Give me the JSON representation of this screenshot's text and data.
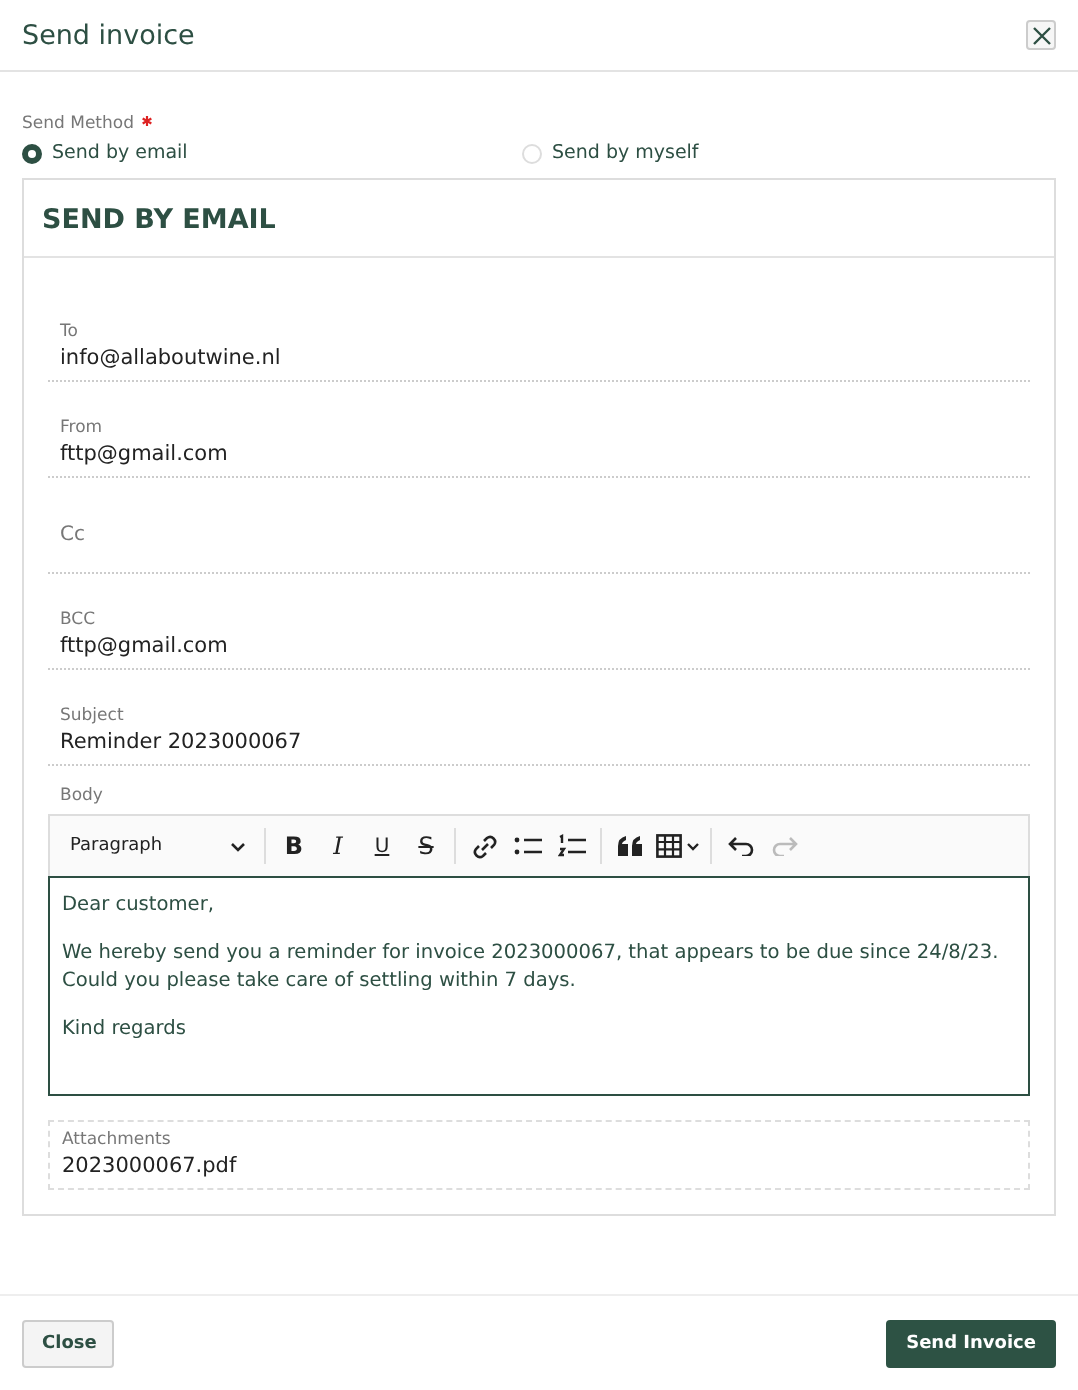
{
  "window": {
    "title": "Send invoice"
  },
  "send_method": {
    "label": "Send Method",
    "required": true,
    "options": [
      {
        "label": "Send by email",
        "selected": true
      },
      {
        "label": "Send by myself",
        "selected": false
      }
    ]
  },
  "card": {
    "title": "SEND BY EMAIL",
    "fields": [
      {
        "label": "To",
        "value": "info@allaboutwine.nl"
      },
      {
        "label": "From",
        "value": "fttp@gmail.com"
      },
      {
        "label": "Cc"
      },
      {
        "label": "BCC",
        "value": "fttp@gmail.com"
      },
      {
        "label": "Subject",
        "value": "Reminder 2023000067"
      }
    ],
    "body": {
      "label": "Body",
      "format": "Paragraph",
      "tool_groups": [
        [
          {
            "kind": "bold",
            "label": "B"
          },
          {
            "kind": "italic",
            "label": "I"
          },
          {
            "kind": "underline",
            "label": "U"
          },
          {
            "kind": "strike",
            "label": "S"
          }
        ],
        [
          {
            "kind": "link"
          },
          {
            "kind": "bullet-list"
          },
          {
            "kind": "numbered-list"
          }
        ],
        [
          {
            "kind": "quote"
          },
          {
            "kind": "table"
          }
        ],
        [
          {
            "kind": "undo",
            "disabled": false
          },
          {
            "kind": "redo",
            "disabled": true
          }
        ]
      ],
      "paragraphs": [
        "Dear customer,",
        "We hereby send you a reminder for invoice 2023000067, that appears to be due since 24/8/23. Could you please take care of settling within 7 days.",
        "Kind regards"
      ]
    },
    "attachments": {
      "label": "Attachments",
      "value": "2023000067.pdf"
    }
  },
  "buttons": [
    {
      "label": "Close",
      "kind": "secondary"
    },
    {
      "label": "Send Invoice",
      "kind": "primary"
    }
  ]
}
